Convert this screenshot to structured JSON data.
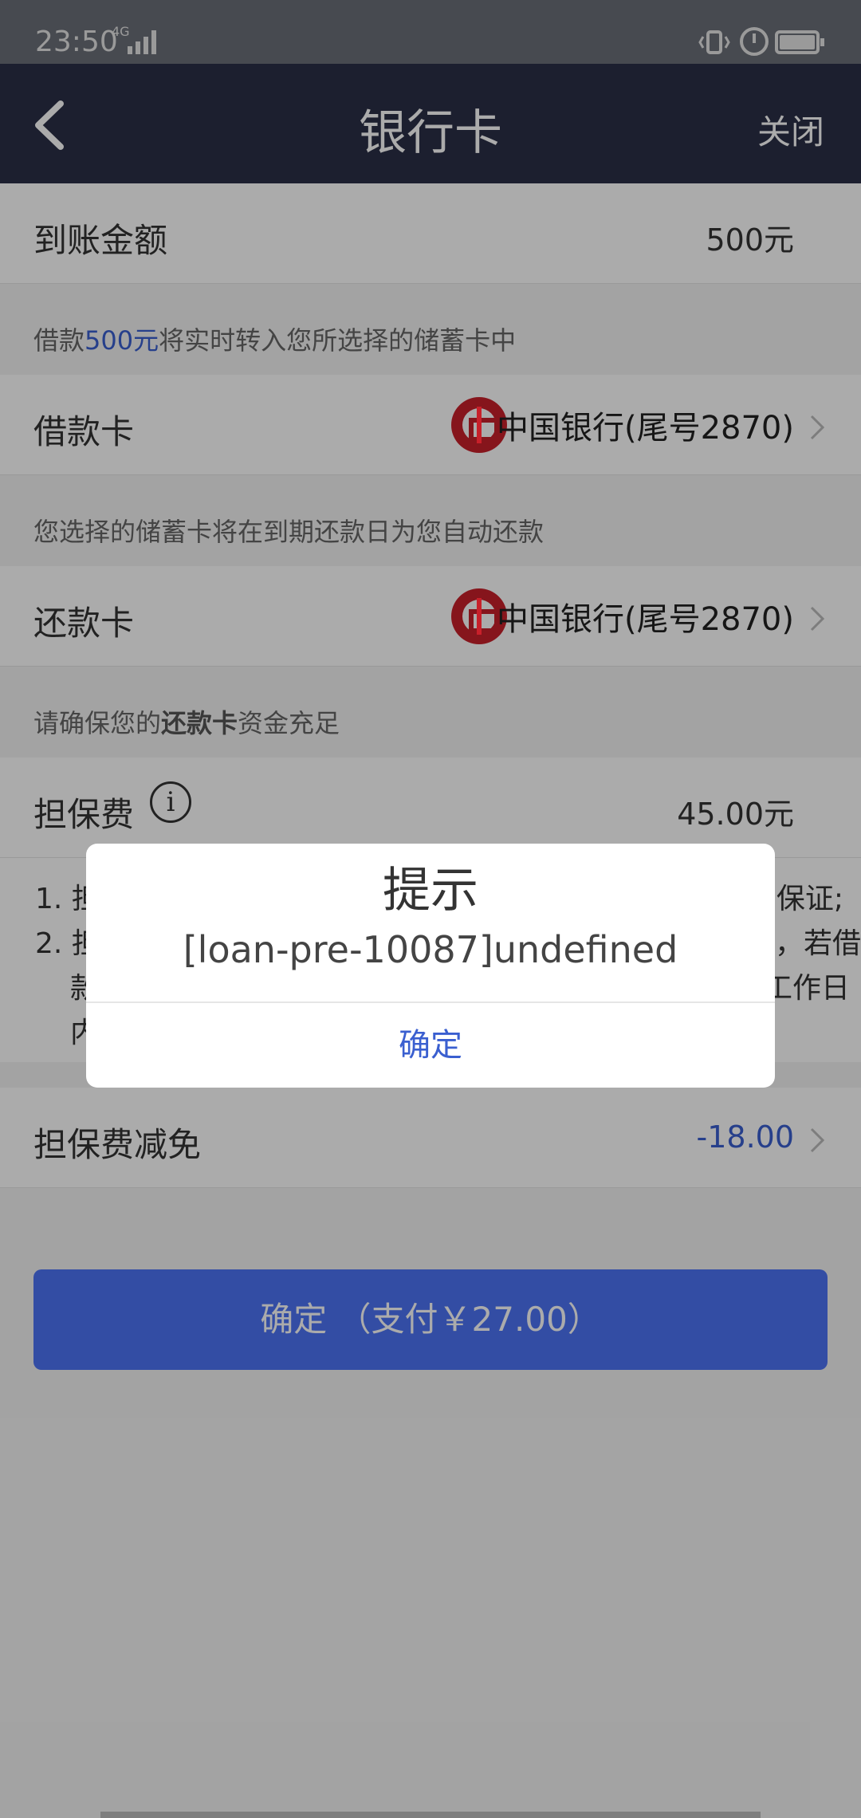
{
  "status_bar": {
    "time": "23:50",
    "network": "4G"
  },
  "header": {
    "title": "银行卡",
    "close_label": "关闭"
  },
  "amount_row": {
    "label": "到账金额",
    "value": "500元"
  },
  "transfer_tip": {
    "prefix": "借款",
    "amount": "500元",
    "suffix": "将实时转入您所选择的储蓄卡中"
  },
  "loan_card_row": {
    "label": "借款卡",
    "bank": "中国银行(尾号2870)"
  },
  "repay_tip": "您选择的储蓄卡将在到期还款日为您自动还款",
  "repay_card_row": {
    "label": "还款卡",
    "bank": "中国银行(尾号2870)"
  },
  "ensure_tip": {
    "prefix": "请确保您的",
    "bold": "还款卡",
    "suffix": "资金充足"
  },
  "fee_row": {
    "label": "担保费",
    "value": "45.00元"
  },
  "fee_notes": {
    "line1_start": "1. 担",
    "line1_end": "保证;",
    "line2_start": "2. 担",
    "line2_end": "，若借",
    "line3_start": "款",
    "line3_end": "工作日",
    "line4_start": "内"
  },
  "discount_row": {
    "label": "担保费减免",
    "value": "-18.00"
  },
  "pay_button": {
    "label": "确定 （支付￥27.00）"
  },
  "dialog": {
    "title": "提示",
    "message": "[loan-pre-10087]undefined",
    "confirm_label": "确定"
  },
  "colors": {
    "header_bg": "#2a2f46",
    "accent_blue": "#3a5fd0",
    "button_blue": "#4c74f5",
    "bank_red": "#c8202a"
  }
}
